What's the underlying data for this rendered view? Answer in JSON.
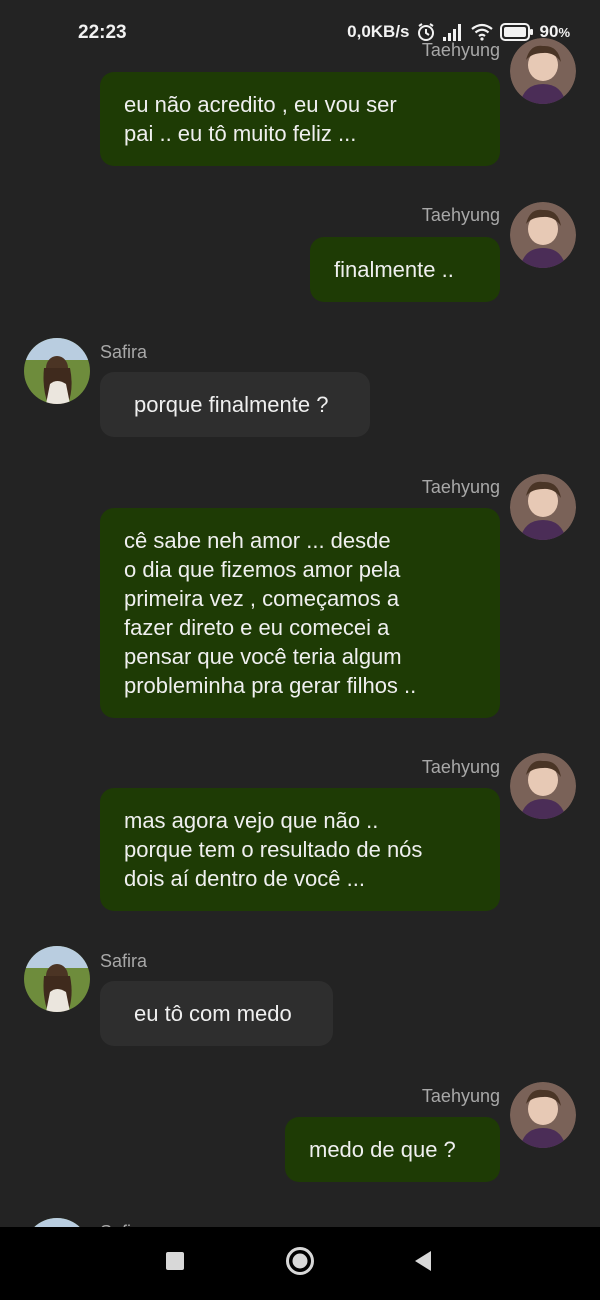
{
  "status_bar": {
    "time": "22:23",
    "net_speed": "0,0KB/s",
    "battery": "90",
    "battery_suffix": "%",
    "icons": [
      "alarm-icon",
      "signal-icon",
      "wifi-icon",
      "battery-icon"
    ]
  },
  "colors": {
    "background": "#232323",
    "sent_bubble": "#1e3b05",
    "received_bubble": "#2e2e2e",
    "nav_bar": "#000000"
  },
  "messages": [
    {
      "sender": "Taehyung",
      "side": "right",
      "text": "eu não acredito , eu vou ser\npai .. eu tô muito feliz ..."
    },
    {
      "sender": "Taehyung",
      "side": "right",
      "text": "finalmente .."
    },
    {
      "sender": "Safira",
      "side": "left",
      "text": "porque finalmente ?"
    },
    {
      "sender": "Taehyung",
      "side": "right",
      "text": "cê sabe neh amor ... desde\no dia que fizemos amor pela\nprimeira vez , começamos a\nfazer direto e eu comecei a\npensar que você teria algum\nprobleminha pra gerar filhos .."
    },
    {
      "sender": "Taehyung",
      "side": "right",
      "text": "mas agora vejo que não ..\nporque tem o resultado de nós\ndois aí dentro de você ..."
    },
    {
      "sender": "Safira",
      "side": "left",
      "text": "eu tô com medo"
    },
    {
      "sender": "Taehyung",
      "side": "right",
      "text": "medo de que ?"
    },
    {
      "sender": "Safira",
      "side": "left",
      "text": ""
    }
  ],
  "nav_bar": {
    "icons": [
      "recents-square-icon",
      "home-circle-icon",
      "back-triangle-icon"
    ]
  }
}
